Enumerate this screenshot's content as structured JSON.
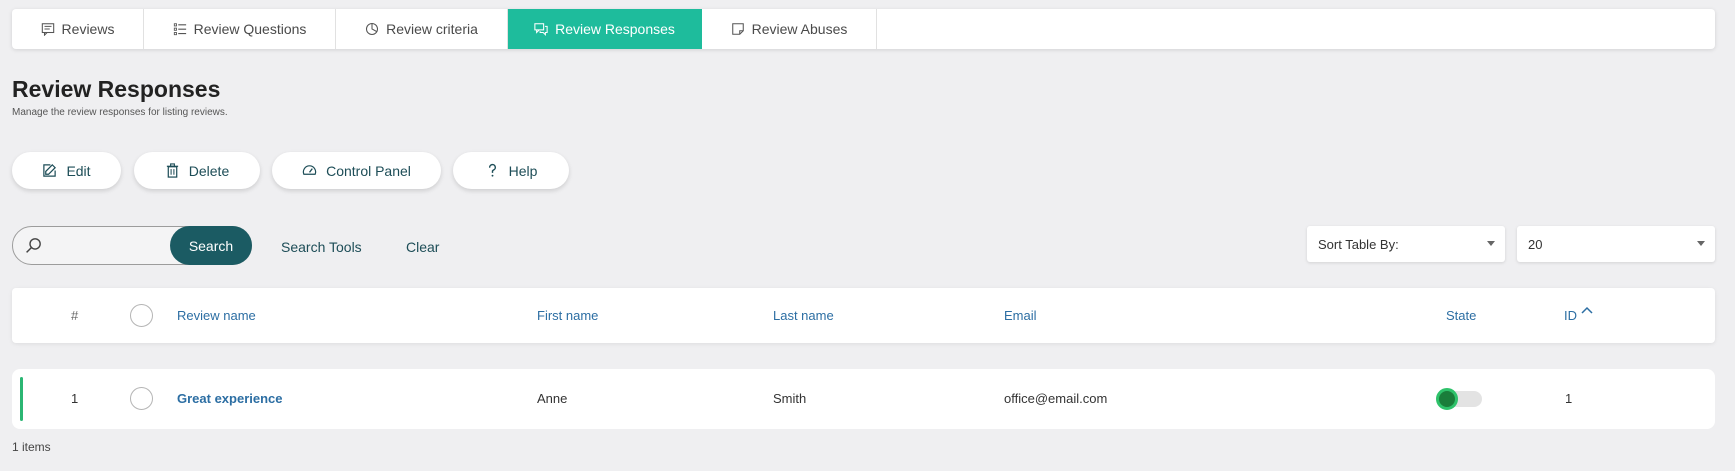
{
  "tabs": [
    {
      "label": "Reviews",
      "icon": "comment-icon"
    },
    {
      "label": "Review Questions",
      "icon": "list-icon"
    },
    {
      "label": "Review criteria",
      "icon": "pie-chart-icon"
    },
    {
      "label": "Review Responses",
      "icon": "comments-icon",
      "active": true
    },
    {
      "label": "Review Abuses",
      "icon": "note-icon"
    }
  ],
  "page": {
    "title": "Review Responses",
    "subtitle": "Manage the review responses for listing reviews."
  },
  "toolbar": {
    "edit_label": "Edit",
    "delete_label": "Delete",
    "control_panel_label": "Control Panel",
    "help_label": "Help"
  },
  "search": {
    "value": "",
    "placeholder": "",
    "button_label": "Search",
    "tools_label": "Search Tools",
    "clear_label": "Clear"
  },
  "sort": {
    "label": "Sort Table By:"
  },
  "page_size": {
    "value": "20"
  },
  "table": {
    "columns": {
      "number": "#",
      "review_name": "Review name",
      "first_name": "First name",
      "last_name": "Last name",
      "email": "Email",
      "state": "State",
      "id": "ID"
    },
    "sort_indicator": "ascending",
    "rows": [
      {
        "number": "1",
        "review_name": "Great experience",
        "first_name": "Anne",
        "last_name": "Smith",
        "email": "office@email.com",
        "state": "enabled",
        "id": "1"
      }
    ]
  },
  "footer": {
    "items_count": "1 items"
  },
  "colors": {
    "accent": "#1ebc9c",
    "dark_button": "#1b5b63",
    "link": "#2c6ea3",
    "row_accent": "#2bb673"
  }
}
